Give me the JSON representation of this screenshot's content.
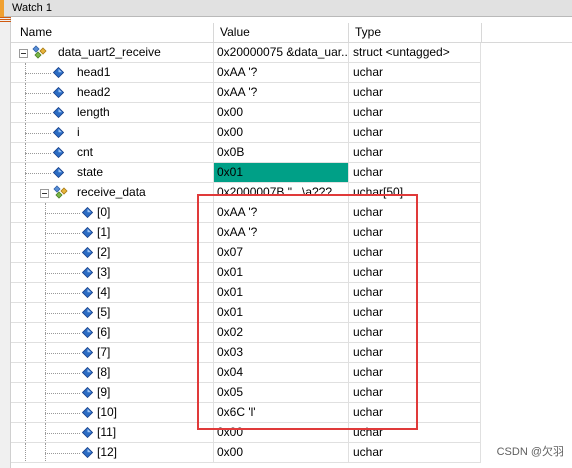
{
  "window": {
    "title": "Watch 1"
  },
  "columns": {
    "name": "Name",
    "value": "Value",
    "type": "Type"
  },
  "rows": [
    {
      "name": "data_uart2_receive",
      "value": "0x20000075 &data_uar...",
      "type": "struct <untagged>",
      "kind": "struct",
      "level": 0
    },
    {
      "name": "head1",
      "value": "0xAA '?",
      "type": "uchar",
      "kind": "var",
      "level": 1
    },
    {
      "name": "head2",
      "value": "0xAA '?",
      "type": "uchar",
      "kind": "var",
      "level": 1
    },
    {
      "name": "length",
      "value": "0x00",
      "type": "uchar",
      "kind": "var",
      "level": 1
    },
    {
      "name": "i",
      "value": "0x00",
      "type": "uchar",
      "kind": "var",
      "level": 1
    },
    {
      "name": "cnt",
      "value": "0x0B",
      "type": "uchar",
      "kind": "var",
      "level": 1
    },
    {
      "name": "state",
      "value": "0x01",
      "type": "uchar",
      "kind": "var",
      "level": 1,
      "highlight": true
    },
    {
      "name": "receive_data",
      "value": "0x2000007B \"...\\a???...",
      "type": "uchar[50]",
      "kind": "struct",
      "level": 1
    },
    {
      "name": "[0]",
      "value": "0xAA '?",
      "type": "uchar",
      "kind": "var",
      "level": 2
    },
    {
      "name": "[1]",
      "value": "0xAA '?",
      "type": "uchar",
      "kind": "var",
      "level": 2
    },
    {
      "name": "[2]",
      "value": "0x07",
      "type": "uchar",
      "kind": "var",
      "level": 2
    },
    {
      "name": "[3]",
      "value": "0x01",
      "type": "uchar",
      "kind": "var",
      "level": 2
    },
    {
      "name": "[4]",
      "value": "0x01",
      "type": "uchar",
      "kind": "var",
      "level": 2
    },
    {
      "name": "[5]",
      "value": "0x01",
      "type": "uchar",
      "kind": "var",
      "level": 2
    },
    {
      "name": "[6]",
      "value": "0x02",
      "type": "uchar",
      "kind": "var",
      "level": 2
    },
    {
      "name": "[7]",
      "value": "0x03",
      "type": "uchar",
      "kind": "var",
      "level": 2
    },
    {
      "name": "[8]",
      "value": "0x04",
      "type": "uchar",
      "kind": "var",
      "level": 2
    },
    {
      "name": "[9]",
      "value": "0x05",
      "type": "uchar",
      "kind": "var",
      "level": 2
    },
    {
      "name": "[10]",
      "value": "0x6C 'l'",
      "type": "uchar",
      "kind": "var",
      "level": 2
    },
    {
      "name": "[11]",
      "value": "0x00",
      "type": "uchar",
      "kind": "var",
      "level": 2
    },
    {
      "name": "[12]",
      "value": "0x00",
      "type": "uchar",
      "kind": "var",
      "level": 2
    }
  ],
  "colors": {
    "highlight": "#00a087",
    "annotation": "#e03a3a",
    "var_icon": "#2b6cc4"
  },
  "watermark": "CSDN @欠羽"
}
